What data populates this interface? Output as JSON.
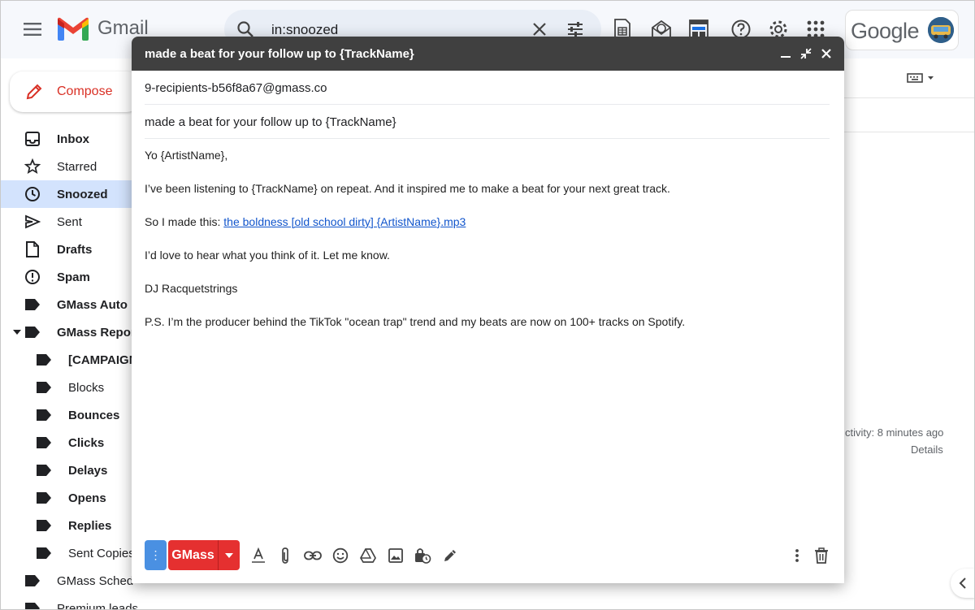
{
  "app": {
    "logo_text": "Gmail",
    "google_text": "Google"
  },
  "search": {
    "value": "in:snoozed"
  },
  "compose_button": {
    "label": "Compose"
  },
  "nav": {
    "items": [
      {
        "label": "Inbox"
      },
      {
        "label": "Starred"
      },
      {
        "label": "Snoozed"
      },
      {
        "label": "Sent"
      },
      {
        "label": "Drafts"
      },
      {
        "label": "Spam"
      },
      {
        "label": "GMass Auto F"
      },
      {
        "label": "GMass Repor"
      },
      {
        "label": "[CAMPAIGN"
      },
      {
        "label": "Blocks"
      },
      {
        "label": "Bounces"
      },
      {
        "label": "Clicks"
      },
      {
        "label": "Delays"
      },
      {
        "label": "Opens"
      },
      {
        "label": "Replies"
      },
      {
        "label": "Sent Copies"
      },
      {
        "label": "GMass Sched"
      },
      {
        "label": "Premium leads"
      }
    ]
  },
  "background": {
    "activity": "ctivity: 8 minutes ago",
    "details": "Details"
  },
  "compose": {
    "title": "made a beat for your follow up to {TrackName}",
    "to": "9-recipients-b56f8a67@gmass.co",
    "subject": "made a beat for your follow up to {TrackName}",
    "body": {
      "greeting": "Yo {ArtistName},",
      "line1": "I’ve been listening to {TrackName} on repeat. And it inspired me to make a beat for your next great track.",
      "line2_prefix": "So I made this: ",
      "line2_link": "the boldness [old school dirty] {ArtistName}.mp3",
      "line3": "I’d love to hear what you think of it. Let me know.",
      "signature": "DJ Racquetstrings",
      "ps": "P.S. I’m the producer behind the TikTok \"ocean trap\" trend and my beats are now on 100+ tracks on Spotify."
    },
    "toolbar": {
      "gmass_label": "GMass",
      "more_label": "⋮"
    }
  },
  "colors": {
    "gmass_red": "#e53030",
    "gmass_blue": "#4a90e2",
    "compose_header": "#404040",
    "link": "#1155cc",
    "snoozed_highlight": "#d3e3fd"
  }
}
